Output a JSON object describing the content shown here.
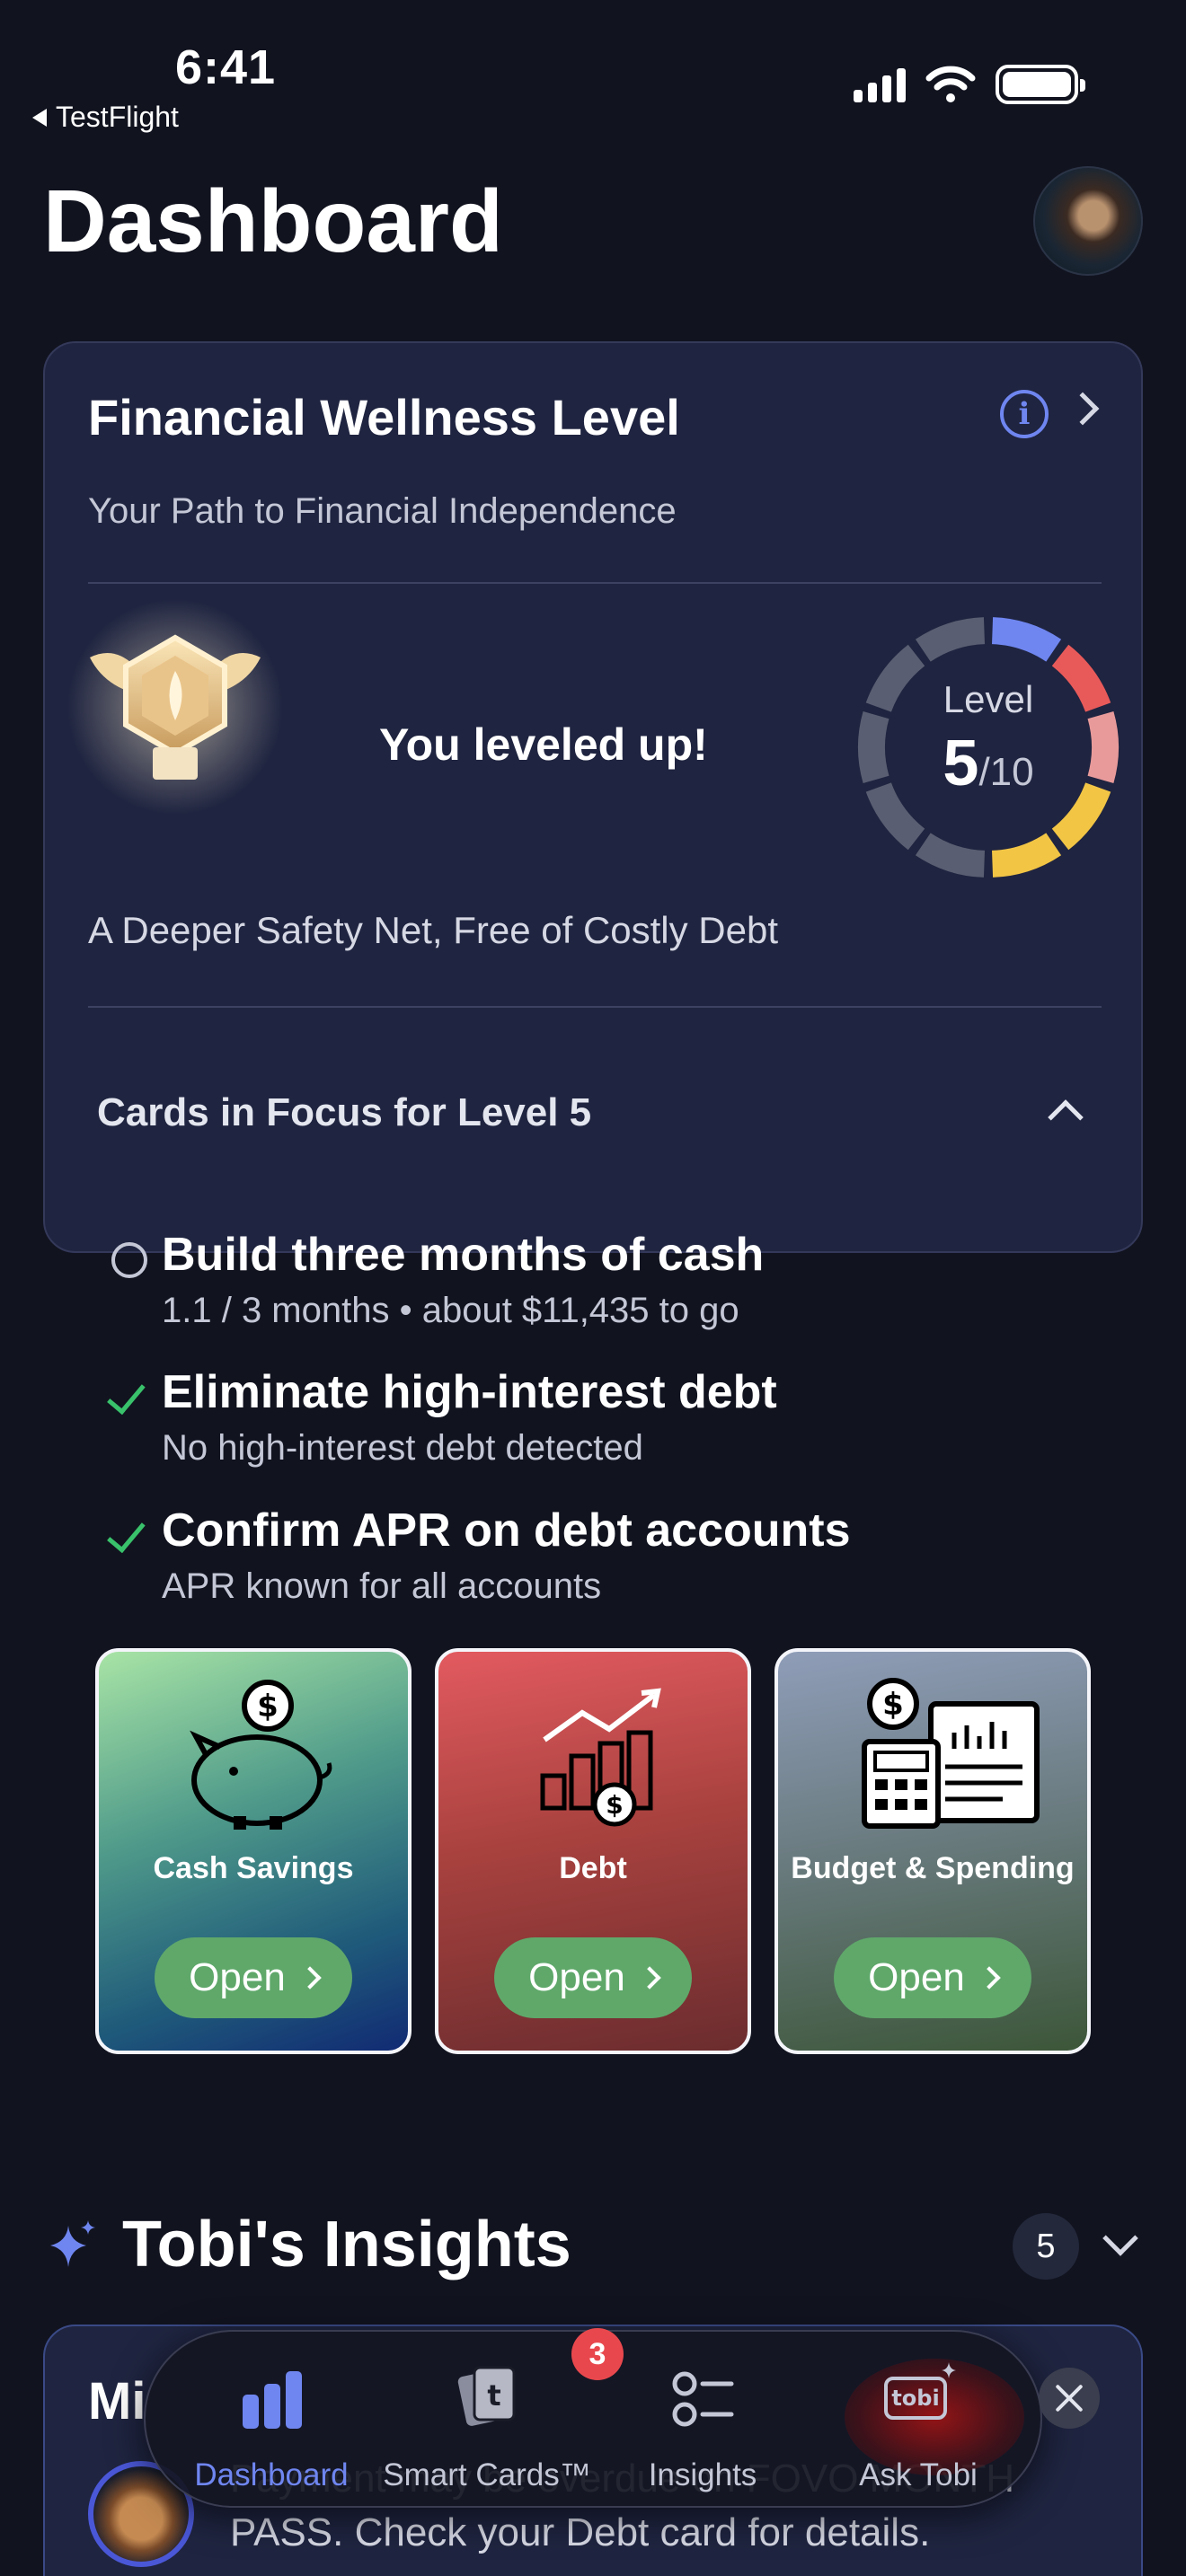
{
  "status_bar": {
    "time": "6:41",
    "back_app": "TestFlight"
  },
  "header": {
    "title": "Dashboard"
  },
  "wellness": {
    "title": "Financial Wellness Level",
    "subtitle": "Your Path to Financial Independence",
    "leveled_up": "You leveled up!",
    "level_label": "Level",
    "level_current": "5",
    "level_total": "/10",
    "level_progress": {
      "current": 5,
      "max": 10
    },
    "tagline": "A Deeper Safety Net, Free of Costly Debt",
    "focus_header": "Cards in Focus for Level 5",
    "ring_colors": [
      "#6f86f0",
      "#e85a5a",
      "#e89a9a",
      "#f2c545",
      "#5a5e72"
    ],
    "tasks": [
      {
        "title": "Build three months of cash",
        "subtitle": "1.1 / 3 months • about $11,435 to go",
        "done": false
      },
      {
        "title": "Eliminate high-interest debt",
        "subtitle": "No high-interest debt detected",
        "done": true
      },
      {
        "title": "Confirm APR on debt accounts",
        "subtitle": "APR known for all accounts",
        "done": true
      }
    ],
    "cards": [
      {
        "label": "Cash Savings",
        "button": "Open",
        "icon": "piggy-bank-icon"
      },
      {
        "label": "Debt",
        "button": "Open",
        "icon": "debt-chart-icon"
      },
      {
        "label": "Budget & Spending",
        "button": "Open",
        "icon": "budget-calculator-icon"
      }
    ]
  },
  "insights": {
    "title": "Tobi's Insights",
    "count": "5",
    "card_heading": "Mi",
    "card_text": "Payment may be overdue on FOVO MONTH PASS. Check your Debt card for details."
  },
  "tab_bar": {
    "tabs": [
      {
        "label": "Dashboard",
        "active": true
      },
      {
        "label": "Smart Cards™",
        "active": false
      },
      {
        "label": "Insights",
        "active": false,
        "badge": "3"
      },
      {
        "label": "Ask Tobi",
        "active": false
      }
    ],
    "accent": "#6f86f0"
  }
}
